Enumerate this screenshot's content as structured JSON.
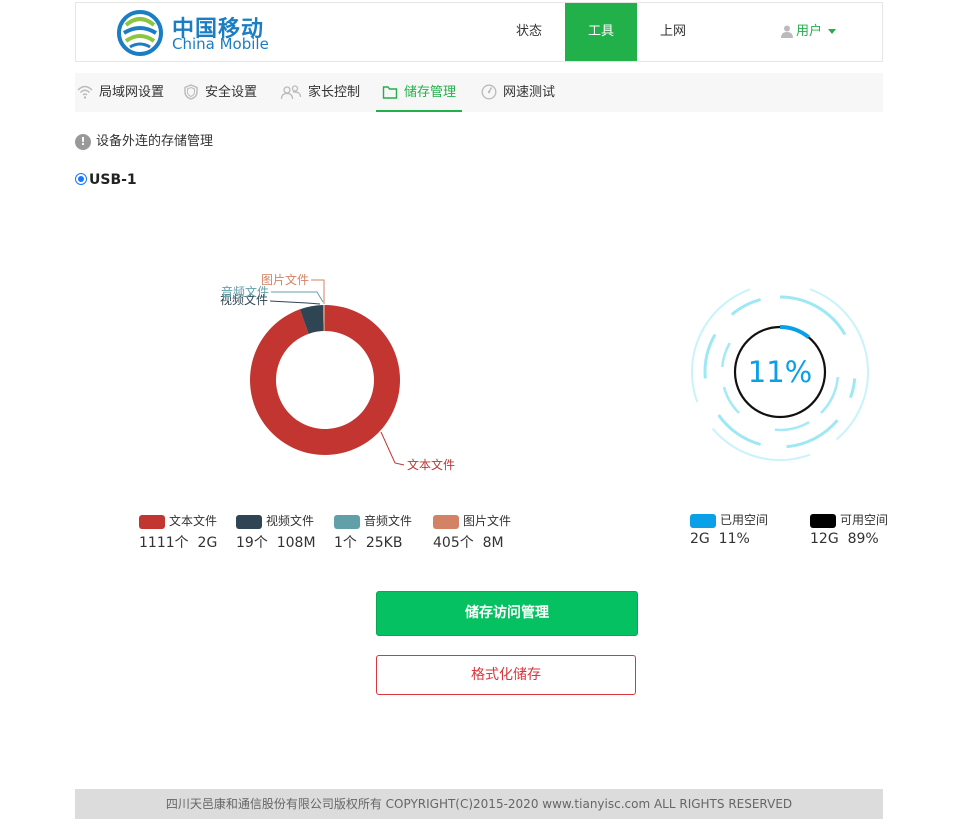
{
  "brand": {
    "name_cn": "中国移动",
    "name_en": "China Mobile",
    "colors": {
      "blue": "#1b7ec4",
      "green": "#22b04b"
    }
  },
  "nav": {
    "items": [
      {
        "label": "状态",
        "active": false
      },
      {
        "label": "工具",
        "active": true
      },
      {
        "label": "上网",
        "active": false
      }
    ],
    "user_label": "用户"
  },
  "tabs": [
    {
      "label": "局域网设置",
      "icon": "wifi-icon",
      "active": false
    },
    {
      "label": "安全设置",
      "icon": "shield-icon",
      "active": false
    },
    {
      "label": "家长控制",
      "icon": "users-icon",
      "active": false
    },
    {
      "label": "储存管理",
      "icon": "folder-icon",
      "active": true
    },
    {
      "label": "网速测试",
      "icon": "speedometer-icon",
      "active": false
    }
  ],
  "notice": "设备外连的存储管理",
  "usb": {
    "label": "USB-1",
    "selected": true
  },
  "file_legend": [
    {
      "name": "文本文件",
      "count": "1111个",
      "size": "2G",
      "color": "#c23531"
    },
    {
      "name": "视频文件",
      "count": "19个",
      "size": "108M",
      "color": "#2f4554"
    },
    {
      "name": "音频文件",
      "count": "1个",
      "size": "25KB",
      "color": "#61a0a8"
    },
    {
      "name": "图片文件",
      "count": "405个",
      "size": "8M",
      "color": "#d48265"
    }
  ],
  "space_legend": [
    {
      "name": "已用空间",
      "size": "2G",
      "percent": "11%",
      "color": "#0aa0e8"
    },
    {
      "name": "可用空间",
      "size": "12G",
      "percent": "89%",
      "color": "#000000"
    }
  ],
  "chart_data": [
    {
      "type": "pie",
      "labels": [
        "文本文件",
        "视频文件",
        "音频文件",
        "图片文件"
      ],
      "values": [
        2048,
        108,
        0.025,
        8
      ],
      "colors": [
        "#c23531",
        "#2f4554",
        "#61a0a8",
        "#d48265"
      ]
    },
    {
      "type": "gauge",
      "value": 11,
      "label": "11%",
      "color": "#0aa0e8"
    }
  ],
  "buttons": {
    "manage": "储存访问管理",
    "format": "格式化储存"
  },
  "footer": "四川天邑康和通信股份有限公司版权所有 COPYRIGHT(C)2015-2020 www.tianyisc.com ALL RIGHTS RESERVED"
}
